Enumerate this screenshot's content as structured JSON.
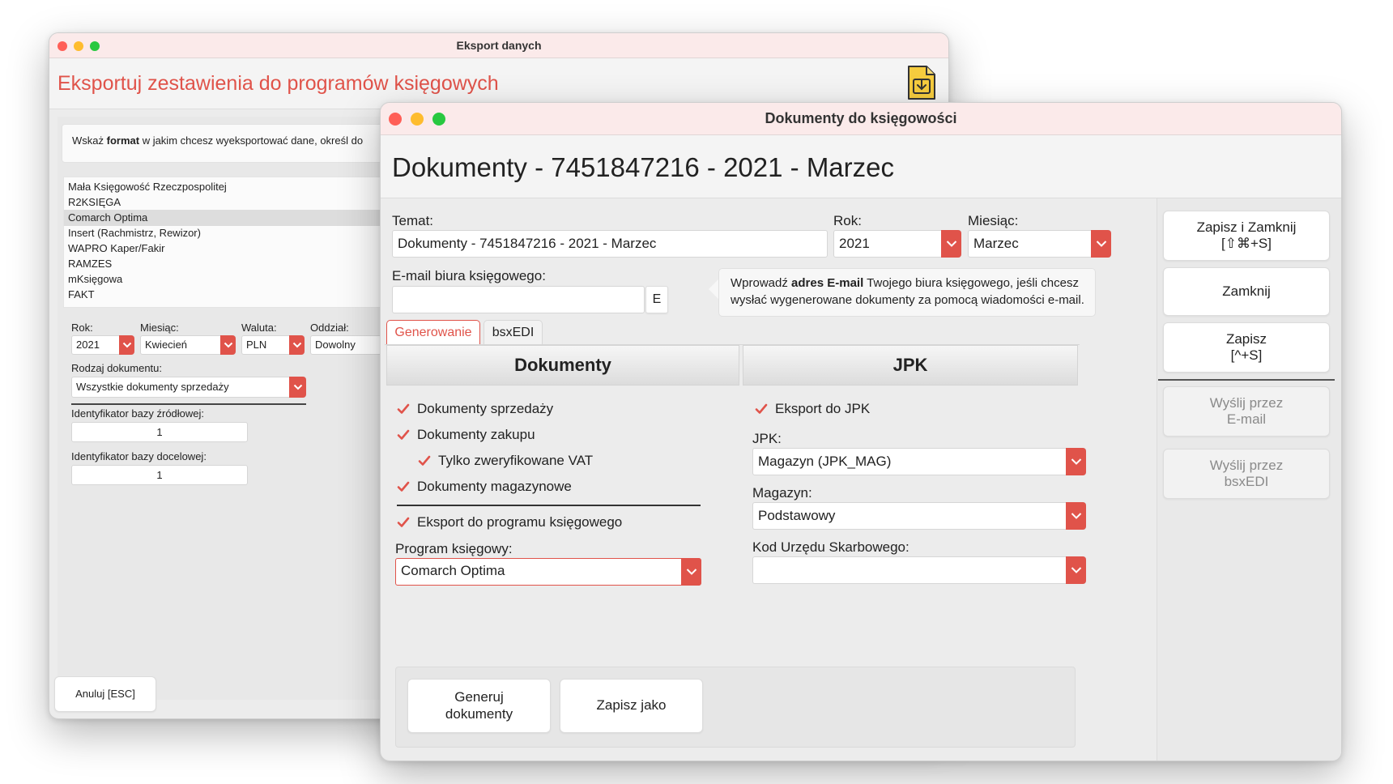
{
  "back_window": {
    "title": "Eksport danych",
    "heading": "Eksportuj zestawienia do programów księgowych",
    "hint_prefix": "Wskaż ",
    "hint_bold": "format",
    "hint_suffix": " w jakim chcesz wyeksportować dane, określ do",
    "formats": [
      "Mała Księgowość Rzeczpospolitej",
      "R2KSIĘGA",
      "Comarch Optima",
      "Insert (Rachmistrz, Rewizor)",
      "WAPRO Kaper/Fakir",
      "RAMZES",
      "mKsięgowa",
      "FAKT"
    ],
    "selected_format_index": 2,
    "rok_label": "Rok:",
    "rok_value": "2021",
    "miesiac_label": "Miesiąc:",
    "miesiac_value": "Kwiecień",
    "waluta_label": "Waluta:",
    "waluta_value": "PLN",
    "oddzial_label": "Oddział:",
    "oddzial_value": "Dowolny",
    "rodzaj_label": "Rodzaj dokumentu:",
    "rodzaj_value": "Wszystkie dokumenty sprzedaży",
    "src_label": "Identyfikator bazy źródłowej:",
    "src_value": "1",
    "dst_label": "Identyfikator bazy docelowej:",
    "dst_value": "1",
    "cancel_label": "Anuluj [ESC]"
  },
  "front_window": {
    "title": "Dokumenty do księgowości",
    "heading": "Dokumenty - 7451847216 - 2021 - Marzec",
    "temat_label": "Temat:",
    "temat_value": "Dokumenty - 7451847216 - 2021 - Marzec",
    "rok_label": "Rok:",
    "rok_value": "2021",
    "miesiac_label": "Miesiąc:",
    "miesiac_value": "Marzec",
    "email_label": "E-mail biura księgowego:",
    "email_value": "",
    "email_button": "E",
    "info_prefix": "Wprowadź ",
    "info_bold": "adres E-mail",
    "info_line1_suffix": " Twojego biura księgowego, jeśli chcesz",
    "info_line2": "wysłać wygenerowane dokumenty za pomocą wiadomości e-mail.",
    "tabs": [
      "Generowanie",
      "bsxEDI"
    ],
    "active_tab": 0,
    "section_docs": "Dokumenty",
    "section_jpk": "JPK",
    "checks": {
      "sprzedazy": "Dokumenty sprzedaży",
      "zakupu": "Dokumenty zakupu",
      "vat": "Tylko zweryfikowane VAT",
      "magazynowe": "Dokumenty magazynowe",
      "eksport_program": "Eksport do programu księgowego",
      "eksport_jpk": "Eksport do JPK"
    },
    "program_label": "Program księgowy:",
    "program_value": "Comarch Optima",
    "jpk_label": "JPK:",
    "jpk_value": "Magazyn (JPK_MAG)",
    "magazyn_label": "Magazyn:",
    "magazyn_value": "Podstawowy",
    "kod_label": "Kod Urzędu Skarbowego:",
    "kod_value": "",
    "generate_button": "Generuj\ndokumenty",
    "save_as_button": "Zapisz jako",
    "side_buttons": {
      "save_close": "Zapisz i Zamknij\n[⇧⌘+S]",
      "close": "Zamknij",
      "save": "Zapisz\n[^+S]",
      "send_email": "Wyślij przez\nE-mail",
      "send_bsxedi": "Wyślij przez\nbsxEDI"
    }
  },
  "colors": {
    "accent": "#e0534a",
    "titlebar": "#fbeaea",
    "close_dot": "#ff5f57",
    "min_dot": "#febc2e",
    "max_dot": "#28c840"
  }
}
